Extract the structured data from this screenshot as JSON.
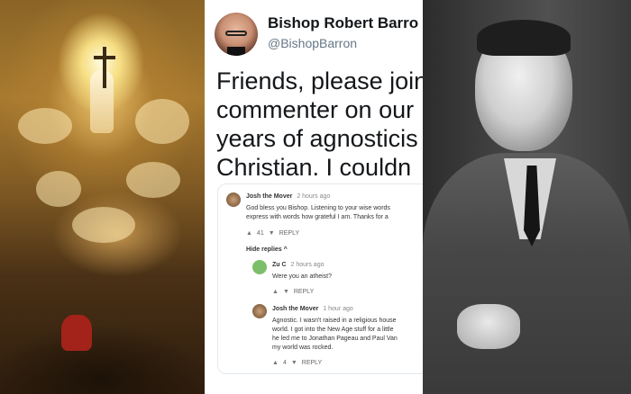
{
  "tweet": {
    "name": "Bishop Robert Barro",
    "handle": "@BishopBarron",
    "text_lines": [
      "Friends, please join",
      "commenter on our",
      "years of agnosticis",
      "Christian. I couldn"
    ]
  },
  "comments": {
    "c1": {
      "author": "Josh the Mover",
      "time": "2 hours ago",
      "lines": [
        "God bless you Bishop. Listening to your wise words",
        "express with words how grateful I am. Thanks for a"
      ],
      "likes": "41",
      "reply_label": "REPLY"
    },
    "hide_replies": "Hide replies ^",
    "c2": {
      "author": "Zu C",
      "time": "2 hours ago",
      "lines": [
        "Were you an atheist?"
      ],
      "reply_label": "REPLY"
    },
    "c3": {
      "author": "Josh the Mover",
      "time": "1 hour ago",
      "lines": [
        "Agnostic. I wasn't raised in a religious house",
        "world. I got into the New Age stuff for a little",
        "he led me to Jonathan Pageau and Paul Van",
        "my world was rocked."
      ],
      "likes": "4",
      "reply_label": "REPLY"
    }
  },
  "icons": {
    "like": "thumbs-up-icon",
    "dislike": "thumbs-down-icon"
  }
}
